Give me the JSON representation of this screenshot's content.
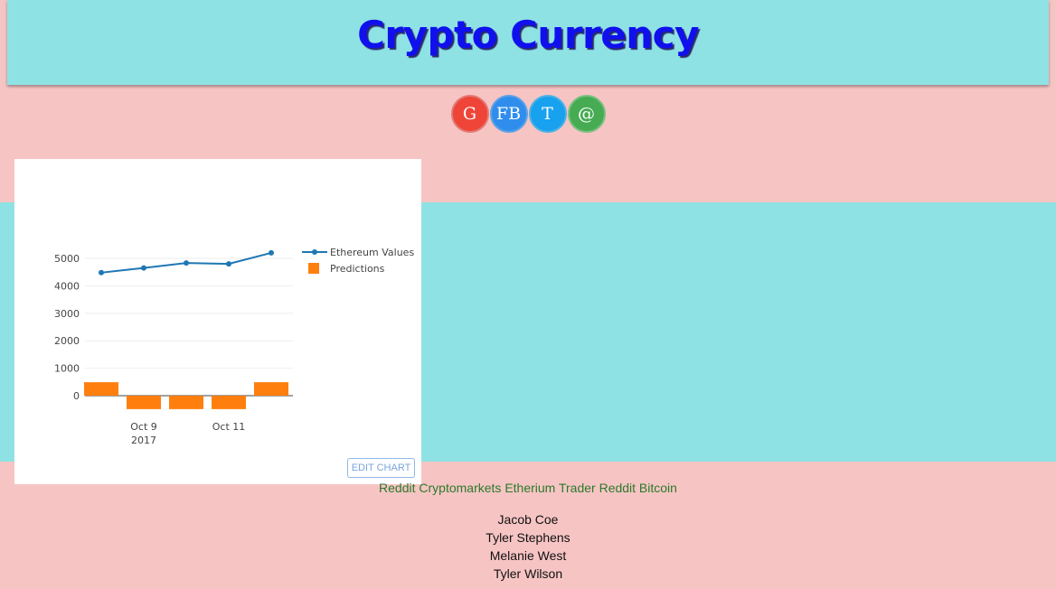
{
  "header": {
    "title": "Crypto Currency"
  },
  "social": [
    {
      "label": "G",
      "icon": "google-icon"
    },
    {
      "label": "FB",
      "icon": "facebook-icon"
    },
    {
      "label": "T",
      "icon": "twitter-icon"
    },
    {
      "label": "@",
      "icon": "email-icon"
    }
  ],
  "chart": {
    "edit_label": "EDIT CHART"
  },
  "chart_data": {
    "type": "line",
    "x": [
      "2017-10-08",
      "2017-10-09",
      "2017-10-10",
      "2017-10-11",
      "2017-10-12"
    ],
    "x_ticks": [
      {
        "x": "2017-10-09",
        "label": "Oct 9",
        "sublabel": "2017"
      },
      {
        "x": "2017-10-11",
        "label": "Oct 11",
        "sublabel": ""
      }
    ],
    "series": [
      {
        "name": "Ethereum Values",
        "type": "line",
        "color": "#1f77b4",
        "values": [
          4480,
          4650,
          4830,
          4800,
          5200
        ]
      },
      {
        "name": "Predictions",
        "type": "bar",
        "color": "#ff7f0e",
        "values": [
          490,
          -490,
          -490,
          -490,
          490
        ]
      }
    ],
    "y_ticks": [
      0,
      1000,
      2000,
      3000,
      4000,
      5000
    ],
    "ylim": [
      -500,
      5300
    ],
    "grid": true,
    "legend": "top-right"
  },
  "links": [
    "Reddit Cryptomarkets",
    "Etherium Trader",
    "Reddit Bitcoin"
  ],
  "names": [
    "Jacob Coe",
    "Tyler Stephens",
    "Melanie West",
    "Tyler Wilson"
  ]
}
